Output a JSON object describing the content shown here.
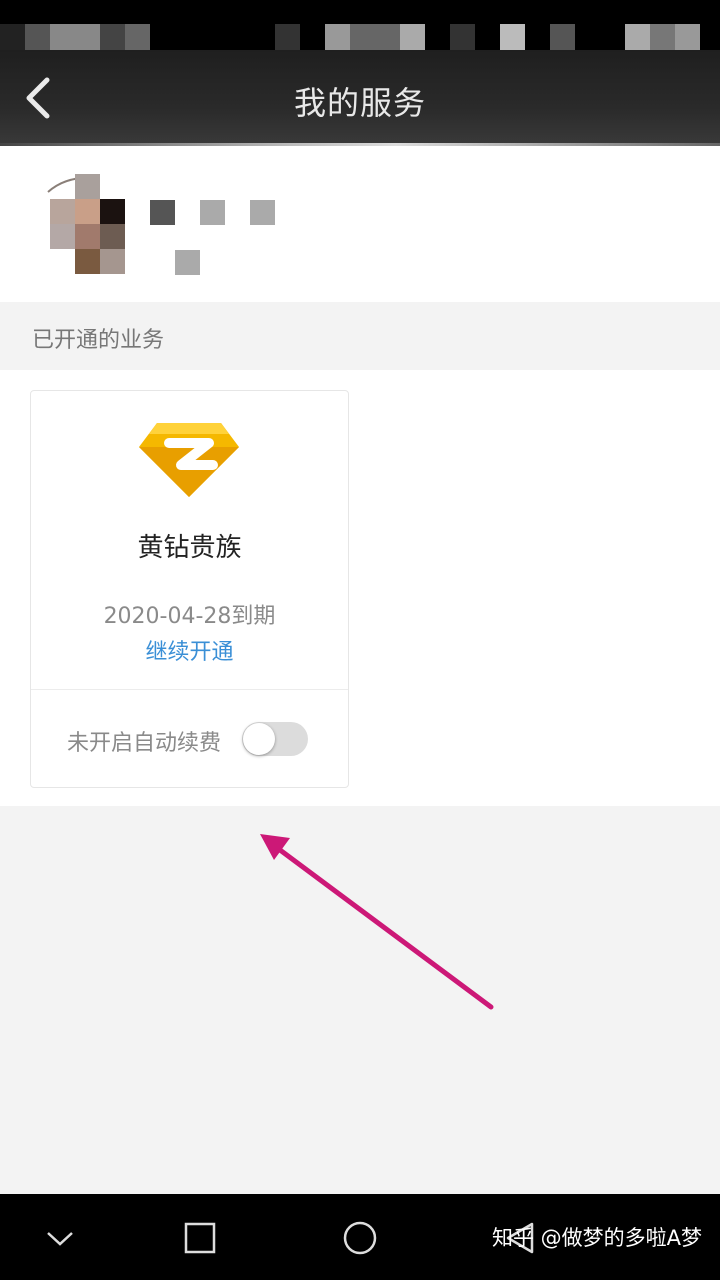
{
  "header": {
    "title": "我的服务"
  },
  "section": {
    "title": "已开通的业务"
  },
  "service": {
    "name": "黄钻贵族",
    "expire": "2020-04-28到期",
    "renew_label": "继续开通",
    "autorenew_label": "未开启自动续费",
    "autorenew_on": false,
    "logo_icon": "yellow-diamond-icon"
  },
  "watermark": {
    "text": "知乎 @做梦的多啦A梦"
  },
  "colors": {
    "link": "#3a8fd6",
    "annotation": "#cc1877",
    "logo": "#f5b800"
  }
}
